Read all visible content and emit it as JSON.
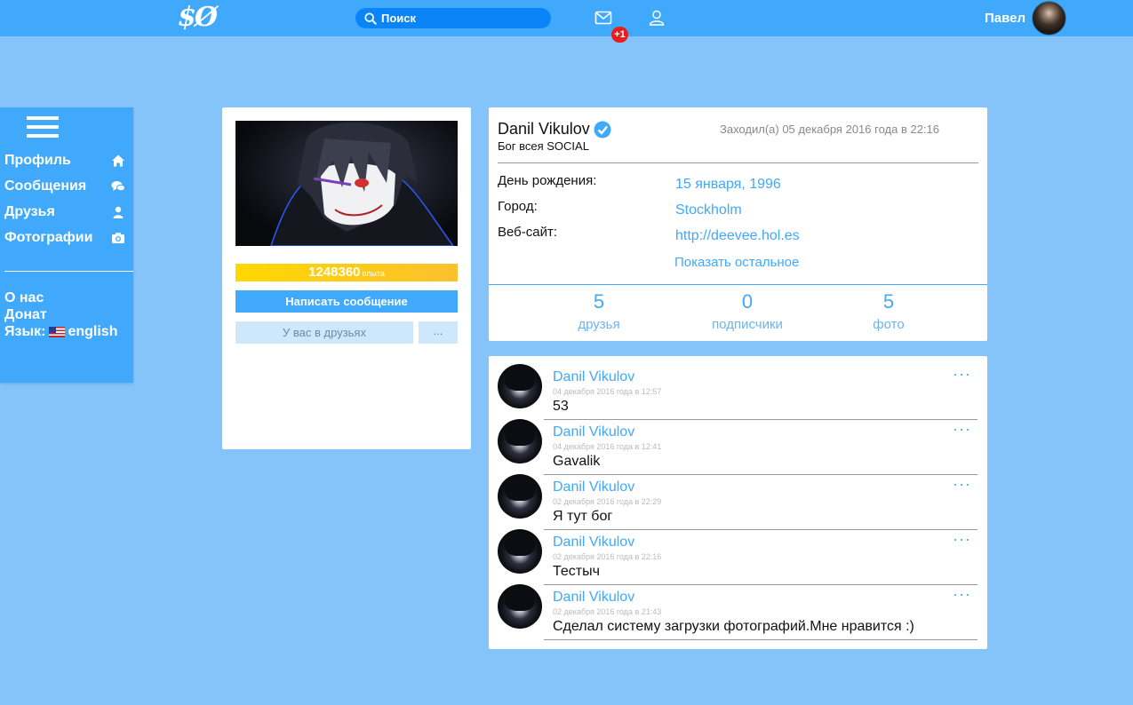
{
  "header": {
    "logo_text": "$Ø",
    "search_placeholder": "Поиск",
    "mail_badge": "+1",
    "username": "Павел"
  },
  "sidebar": {
    "items": [
      {
        "label": "Профиль",
        "icon": "home-icon"
      },
      {
        "label": "Сообщения",
        "icon": "chat-bubbles-icon"
      },
      {
        "label": "Друзья",
        "icon": "person-icon"
      },
      {
        "label": "Фотографии",
        "icon": "camera-icon"
      }
    ],
    "about": "О нас",
    "donate": "Донат",
    "language_label": "Язык:",
    "language_value": "english"
  },
  "profile_card": {
    "xp_value": "1248360",
    "xp_unit": "опыта",
    "write_message": "Написать сообщение",
    "friends_status": "У вас в друзьях",
    "more_button": "..."
  },
  "info": {
    "name": "Danil Vikulov",
    "status": "Бог всея SOCIAL",
    "last_seen": "Заходил(а) 05 декабря 2016 года в 22:16",
    "fields": [
      {
        "label": "День рождения:",
        "value": "15 января, 1996"
      },
      {
        "label": "Город:",
        "value": "Stockholm"
      },
      {
        "label": "Веб-сайт:",
        "value": "http://deevee.hol.es"
      }
    ],
    "show_more": "Показать остальное",
    "stats": [
      {
        "num": "5",
        "label": "друзья"
      },
      {
        "num": "0",
        "label": "подписчики"
      },
      {
        "num": "5",
        "label": "фото"
      }
    ]
  },
  "posts": [
    {
      "author": "Danil Vikulov",
      "date": "04 декабря 2016 года в 12:57",
      "text": "53"
    },
    {
      "author": "Danil Vikulov",
      "date": "04 декабря 2016 года в 12:41",
      "text": "Gavalik"
    },
    {
      "author": "Danil Vikulov",
      "date": "02 декабря 2016 года в 22:29",
      "text": "Я тут бог"
    },
    {
      "author": "Danil Vikulov",
      "date": "02 декабря 2016 года в 22:16",
      "text": "Тестыч"
    },
    {
      "author": "Danil Vikulov",
      "date": "02 декабря 2016 года в 21:43",
      "text": "Сделал систему загрузки фотографий.Мне нравится :)"
    }
  ],
  "post_menu": "···",
  "colors": {
    "background": "#84c4fb",
    "header": "#41a9fb",
    "accent": "#41a9fb",
    "xp_gold": "#ffd800",
    "badge_red": "#e81d1d"
  }
}
